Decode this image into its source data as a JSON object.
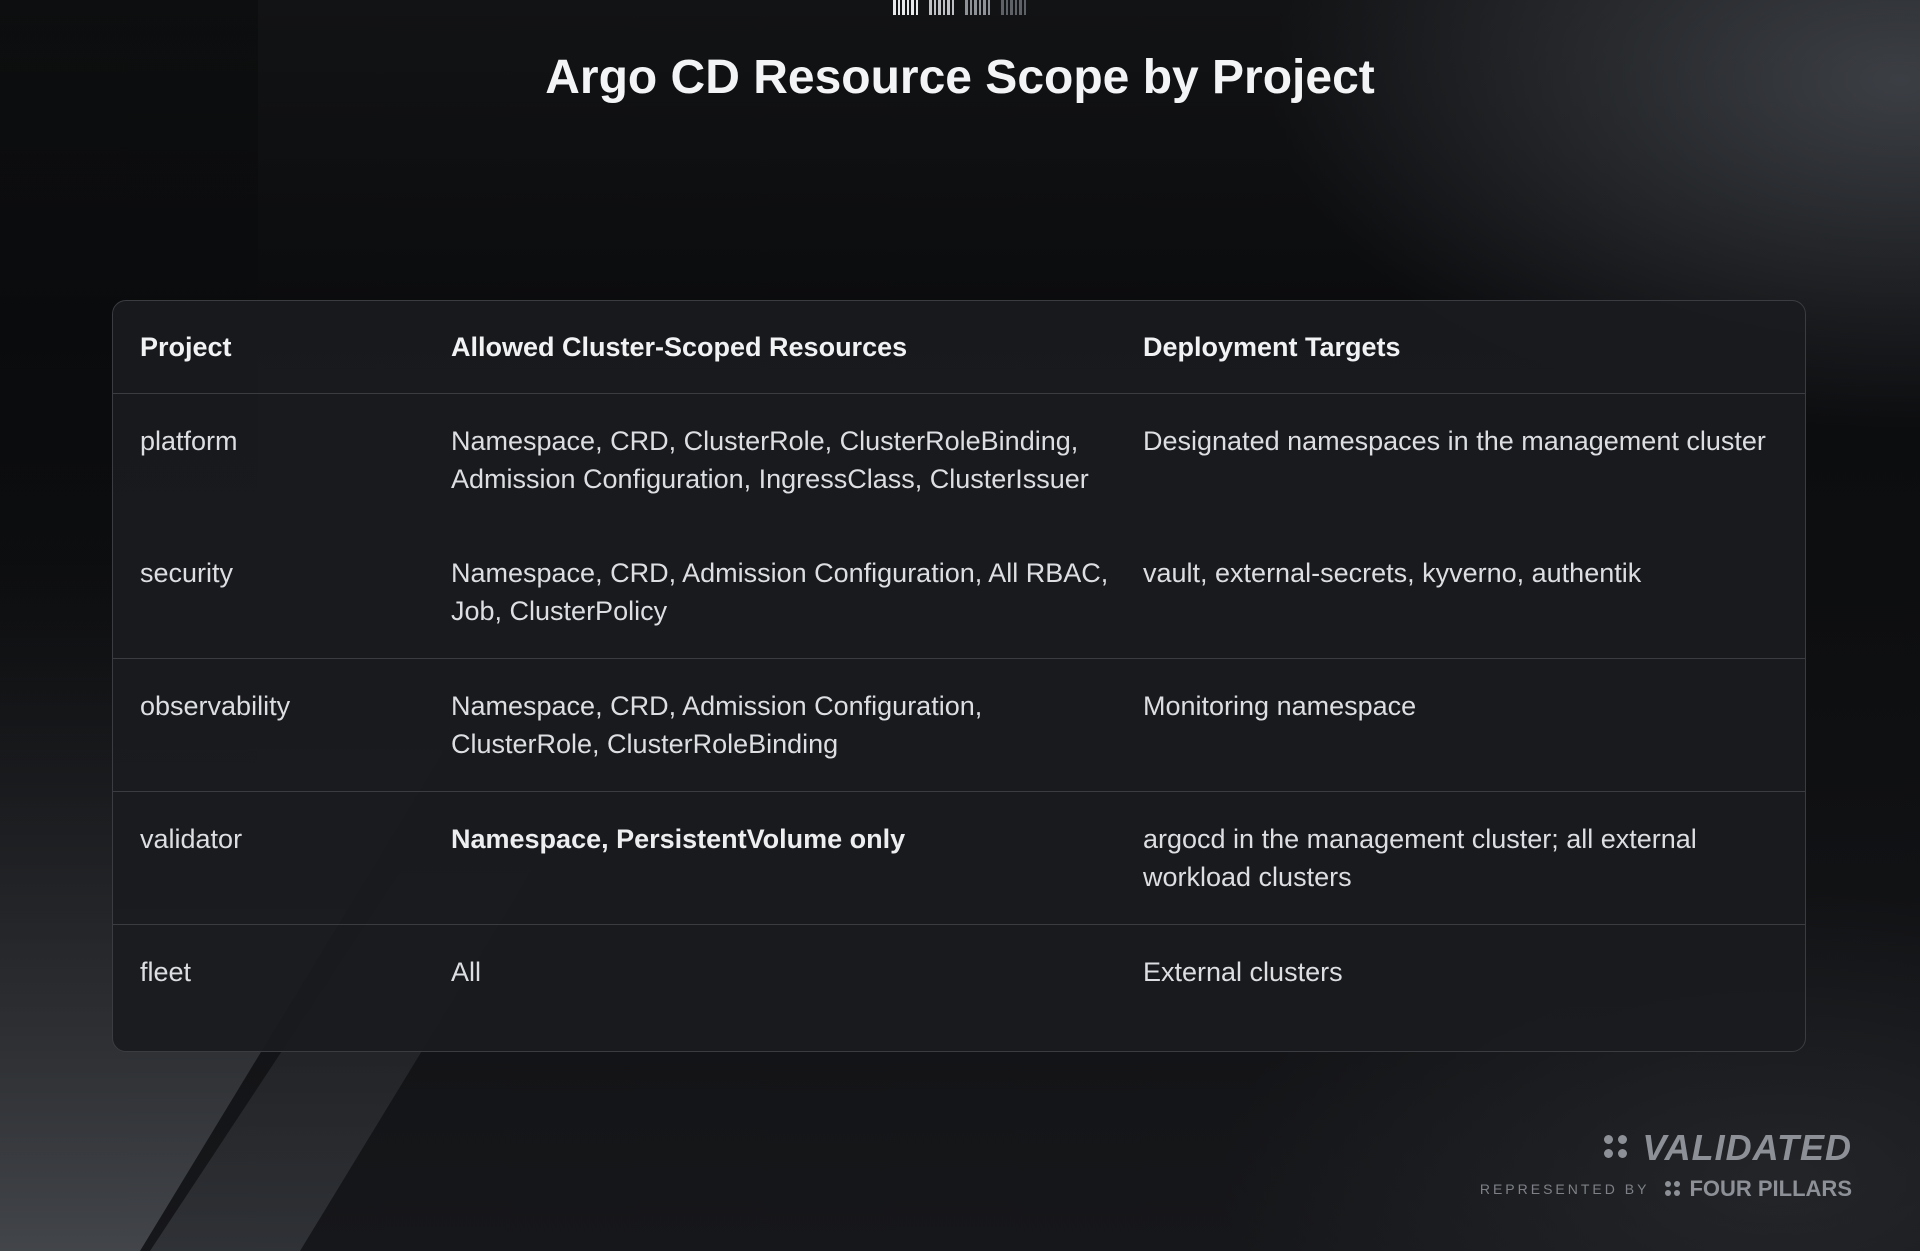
{
  "title": "Argo CD Resource Scope by Project",
  "table": {
    "headers": [
      "Project",
      "Allowed Cluster-Scoped Resources",
      "Deployment Targets"
    ],
    "rows": [
      {
        "project": "platform",
        "resources": "Namespace, CRD, ClusterRole, ClusterRoleBinding, Admission Configuration, IngressClass, ClusterIssuer",
        "targets": "Designated namespaces in the management cluster",
        "resources_bold": false
      },
      {
        "project": "security",
        "resources": "Namespace, CRD, Admission Configuration, All RBAC, Job, ClusterPolicy",
        "targets": "vault, external-secrets, kyverno, authentik",
        "resources_bold": false
      },
      {
        "project": "observability",
        "resources": "Namespace, CRD, Admission Configuration, ClusterRole, ClusterRoleBinding",
        "targets": "Monitoring namespace",
        "resources_bold": false
      },
      {
        "project": "validator",
        "resources": "Namespace, PersistentVolume only",
        "targets": "argocd in the management cluster; all external workload clusters",
        "resources_bold": true
      },
      {
        "project": "fleet",
        "resources": "All",
        "targets": "External clusters",
        "resources_bold": false
      }
    ]
  },
  "branding": {
    "logo_text": "VALIDATED",
    "represented_by": "REPRESENTED BY",
    "partner": "FOUR PILLARS"
  },
  "colors": {
    "background": "#0d0e10",
    "table_bg": "#1a1b1e",
    "border": "#3a3c41",
    "text": "#dcdee1",
    "logo": "#8d9096"
  }
}
